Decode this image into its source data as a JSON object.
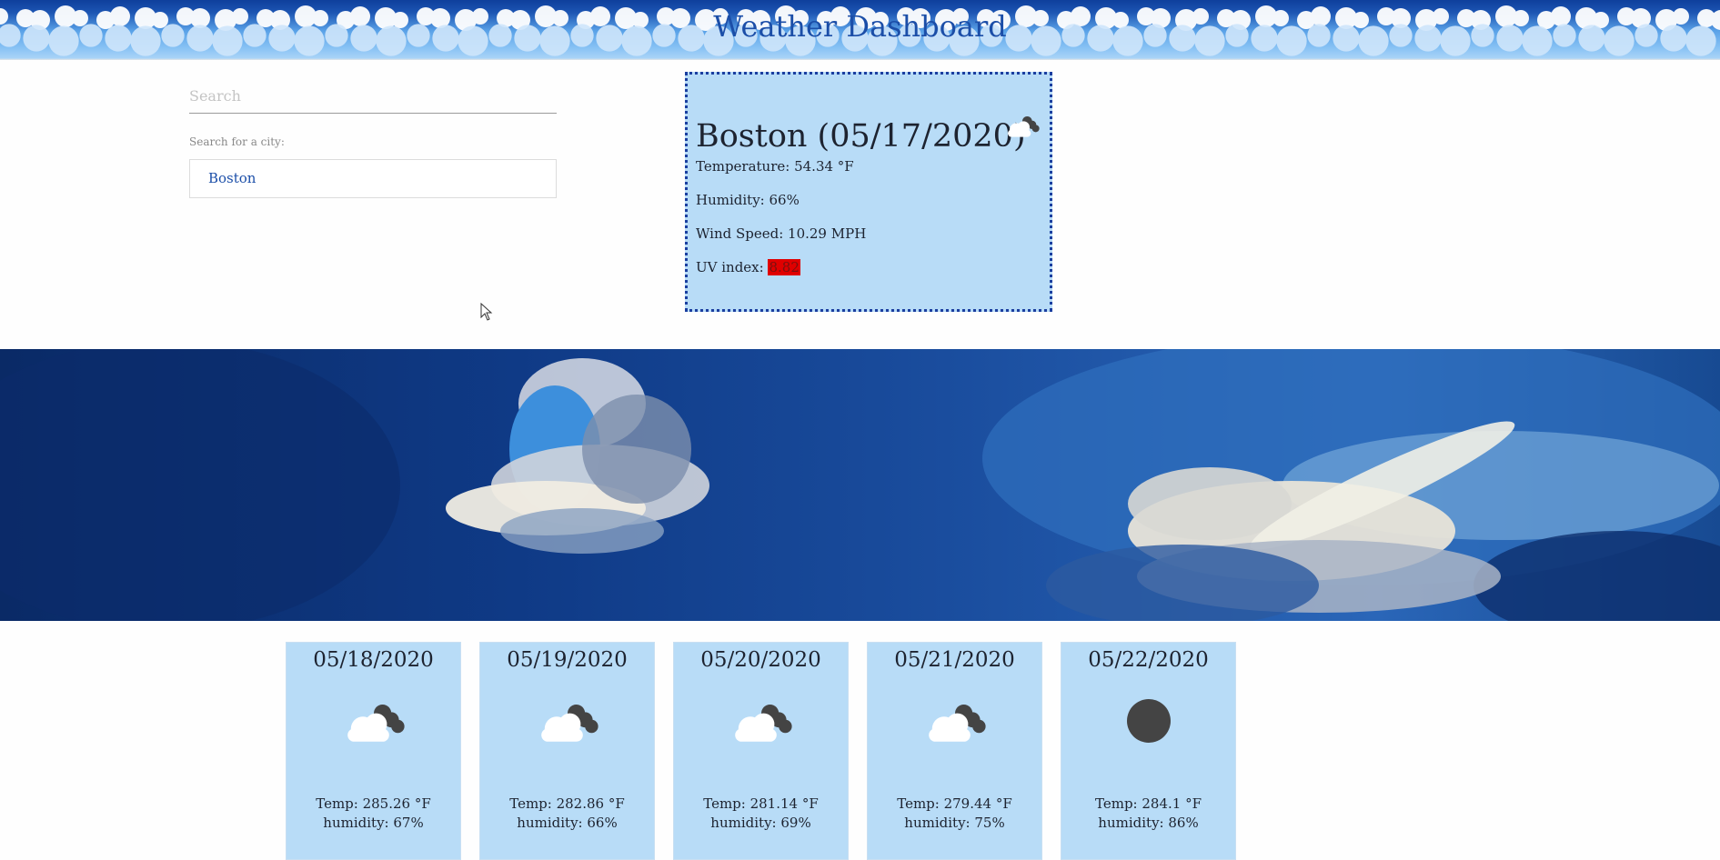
{
  "header": {
    "title": "Weather Dashboard"
  },
  "search": {
    "placeholder": "Search",
    "help_text": "Search for a city:",
    "history": [
      {
        "label": "Boston"
      }
    ]
  },
  "current": {
    "city_date": "Boston (05/17/2020)",
    "icon": "broken-clouds-icon",
    "temperature_text": "Temperature: 54.34 °F",
    "humidity_text": "Humidity: 66%",
    "wind_text": "Wind Speed: 10.29 MPH",
    "uv_label": "UV index: ",
    "uv_value": "8.82",
    "uv_color": "#e00000"
  },
  "forecast": [
    {
      "date": "05/18/2020",
      "icon": "broken-clouds-icon",
      "temp": "Temp: 285.26 °F",
      "humidity": "humidity: 67%"
    },
    {
      "date": "05/19/2020",
      "icon": "broken-clouds-icon",
      "temp": "Temp: 282.86 °F",
      "humidity": "humidity: 66%"
    },
    {
      "date": "05/20/2020",
      "icon": "broken-clouds-icon",
      "temp": "Temp: 281.14 °F",
      "humidity": "humidity: 69%"
    },
    {
      "date": "05/21/2020",
      "icon": "broken-clouds-icon",
      "temp": "Temp: 279.44 °F",
      "humidity": "humidity: 75%"
    },
    {
      "date": "05/22/2020",
      "icon": "clear-night-icon",
      "temp": "Temp: 284.1 °F",
      "humidity": "humidity: 86%"
    }
  ],
  "colors": {
    "card_bg": "#b8dcf7",
    "card_border": "#1b3fa0",
    "title": "#1b4ea8",
    "link": "#1b4ea8"
  }
}
